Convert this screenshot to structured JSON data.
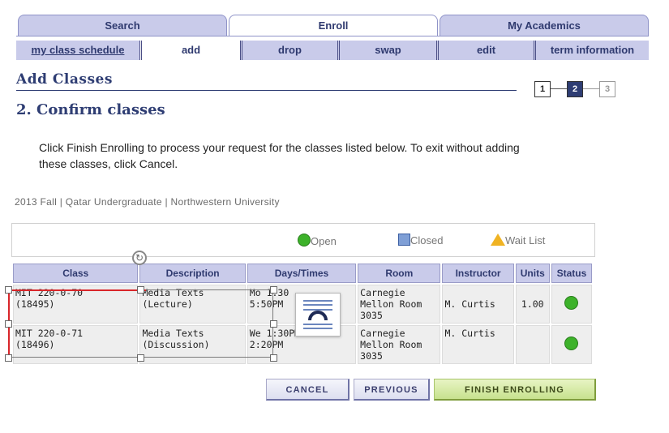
{
  "top_tabs": [
    "Search",
    "Enroll",
    "My Academics"
  ],
  "sub_tabs": [
    "my class schedule",
    "add",
    "drop",
    "swap",
    "edit",
    "term information"
  ],
  "page": {
    "title": "Add Classes",
    "step_title": "2.  Confirm classes",
    "steps": [
      "1",
      "2",
      "3"
    ],
    "instructions": "Click Finish Enrolling to process your request for the classes listed below. To exit without adding these classes, click Cancel.",
    "term_line": "2013 Fall | Qatar Undergraduate | Northwestern University"
  },
  "legend": {
    "open": "Open",
    "closed": "Closed",
    "wait_list": "Wait List"
  },
  "table": {
    "headers": [
      "Class",
      "Description",
      "Days/Times",
      "Room",
      "Instructor",
      "Units",
      "Status"
    ],
    "rows": [
      {
        "class_line1": "MIT 220-0-70",
        "class_line2": "(18495)",
        "desc_line1": "Media Texts",
        "desc_line2": "(Lecture)",
        "days_line1": "Mo 1:30",
        "days_line2": "5:50PM",
        "room_line1": "Carnegie",
        "room_line2": "Mellon Room",
        "room_line3": "3035",
        "instructor": "M. Curtis",
        "units": "1.00",
        "status": "open"
      },
      {
        "class_line1": "MIT 220-0-71",
        "class_line2": "(18496)",
        "desc_line1": "Media Texts",
        "desc_line2": "(Discussion)",
        "days_line1": "We 1:30PM -",
        "days_line2": "2:20PM",
        "room_line1": "Carnegie",
        "room_line2": "Mellon Room",
        "room_line3": "3035",
        "instructor": "M. Curtis",
        "units": "",
        "status": "open"
      }
    ]
  },
  "buttons": {
    "cancel": "CANCEL",
    "previous": "PREVIOUS",
    "finish": "FINISH ENROLLING"
  },
  "colors": {
    "tab_bg": "#c9cbea",
    "title_color": "#2e3d73",
    "open_green": "#3db22a",
    "closed_blue": "#7f9fd6",
    "wait_yellow": "#f0b323",
    "selection_red": "#d9262a"
  }
}
